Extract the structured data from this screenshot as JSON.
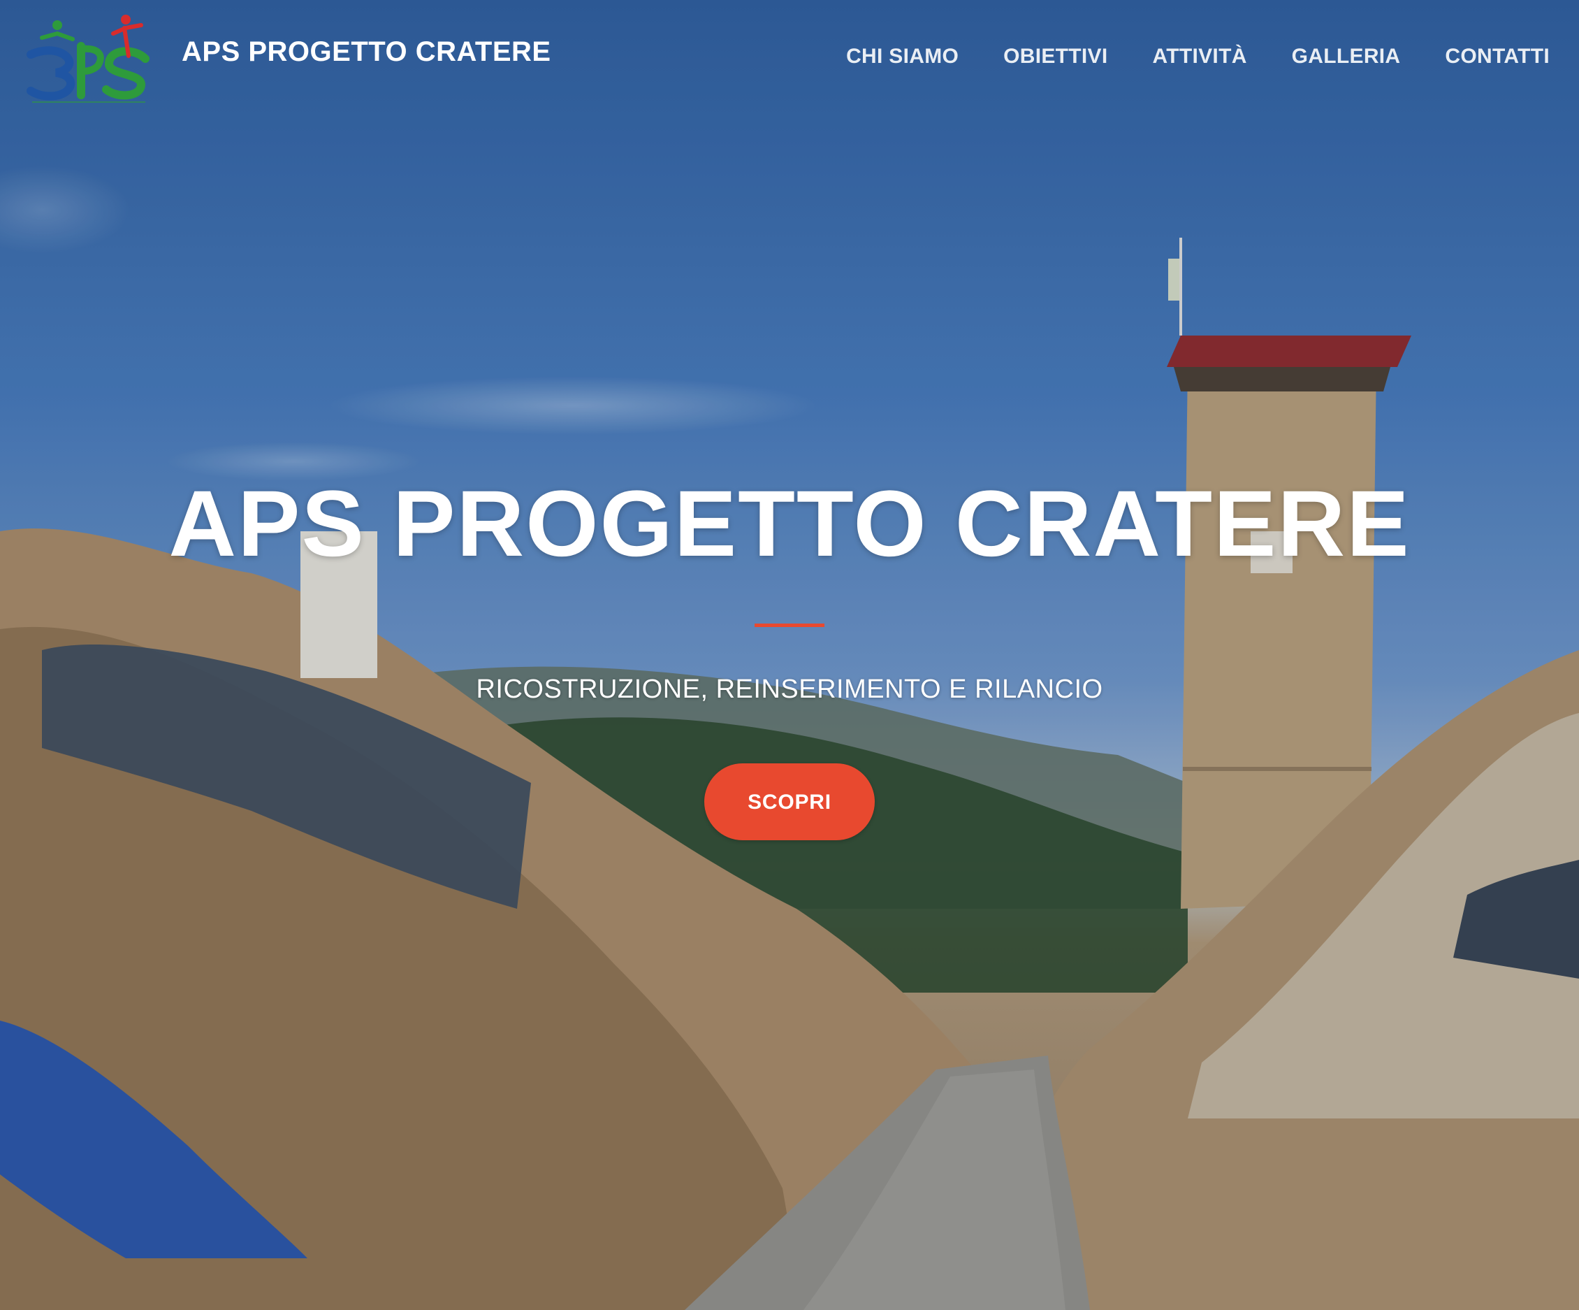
{
  "brand": {
    "name": "APS PROGETTO CRATERE",
    "logo_icon": "progetto-cratere-logo",
    "logo_colors": [
      "#1f55a3",
      "#2e9b3b",
      "#d82c2c"
    ]
  },
  "nav": {
    "items": [
      {
        "label": "CHI SIAMO"
      },
      {
        "label": "OBIETTIVI"
      },
      {
        "label": "ATTIVITÀ"
      },
      {
        "label": "GALLERIA"
      },
      {
        "label": "CONTATTI"
      }
    ]
  },
  "hero": {
    "title": "APS PROGETTO CRATERE",
    "subtitle": "RICOSTRUZIONE, REINSERIMENTO E RILANCIO",
    "cta_label": "SCOPRI",
    "background_image": "earthquake-ruins-photo"
  },
  "colors": {
    "accent": "#e8492f",
    "text": "#ffffff"
  }
}
